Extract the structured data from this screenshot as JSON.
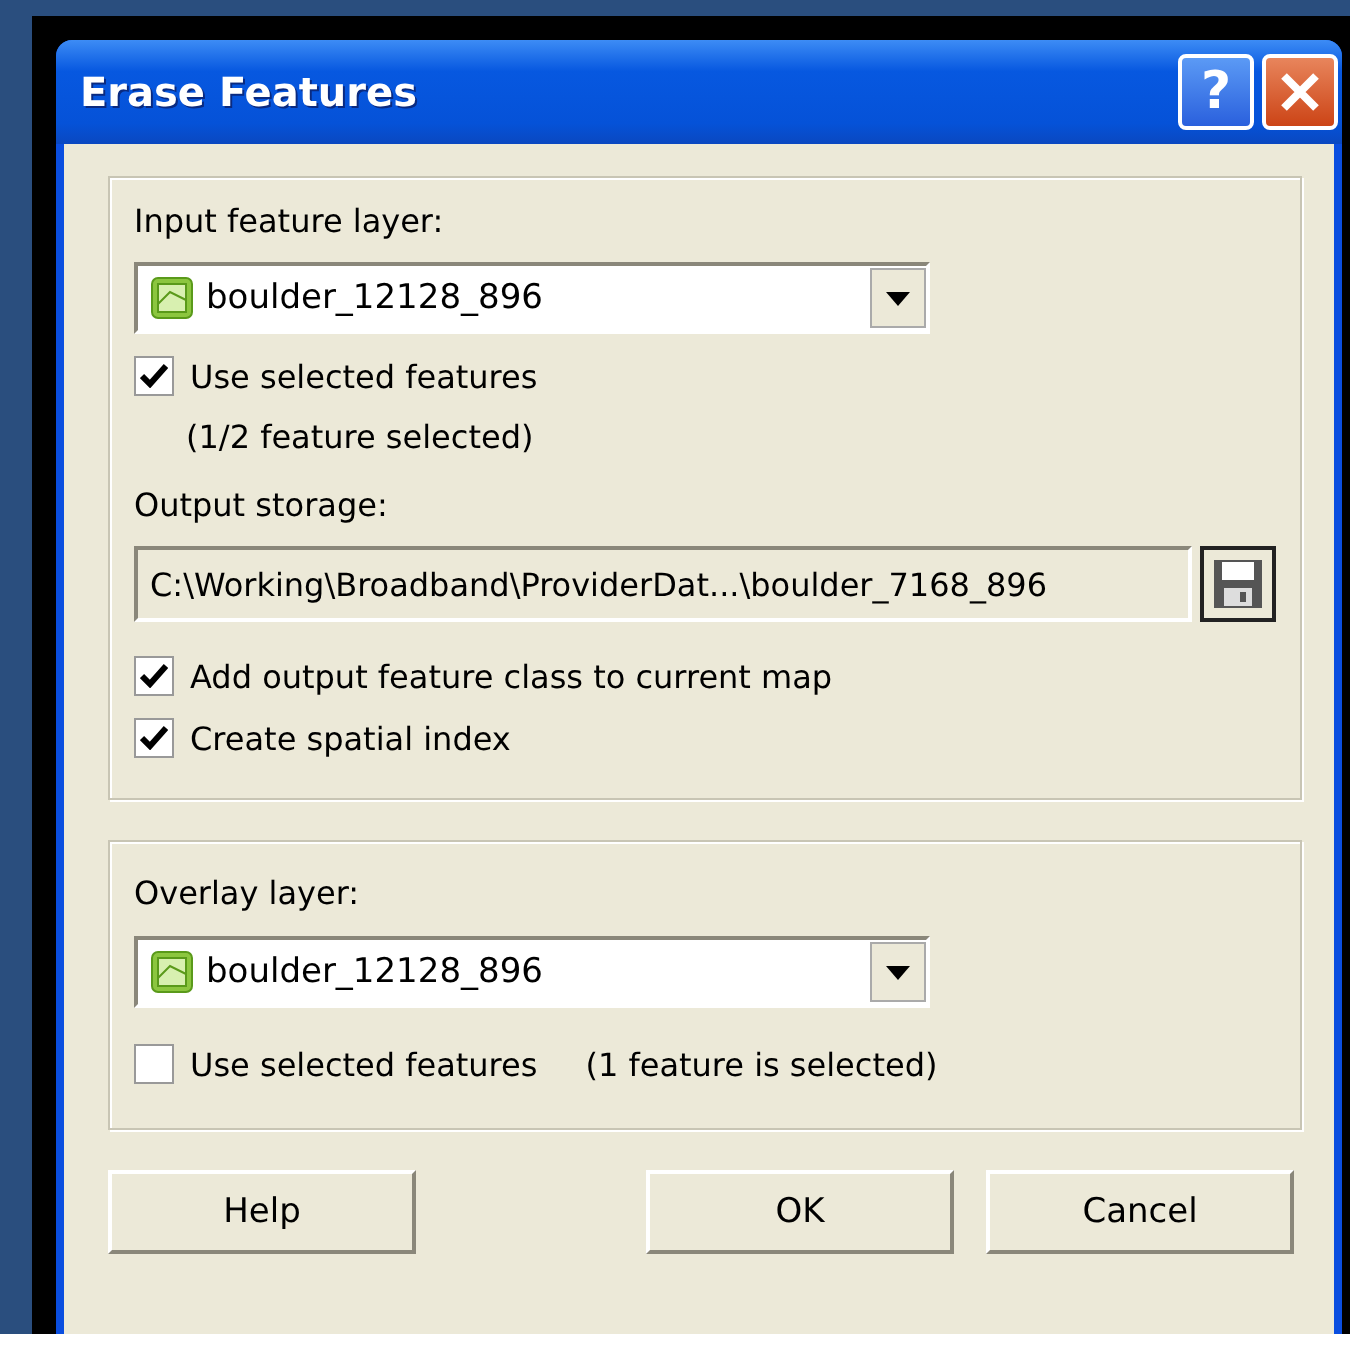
{
  "window": {
    "title": "Erase Features"
  },
  "title_buttons": [
    {
      "kind": "help",
      "label": "?"
    },
    {
      "kind": "close"
    }
  ],
  "input_group": {
    "label": "Input feature layer:",
    "layer": {
      "value": "boulder_12128_896"
    },
    "use_selected": {
      "label": "Use selected features",
      "checked": true
    },
    "selection_note": "(1/2 feature selected)",
    "output_label": "Output storage:",
    "output_path": "C:\\Working\\Broadband\\ProviderDat...\\boulder_7168_896",
    "options": [
      {
        "label": "Add output feature class to current map",
        "checked": true
      },
      {
        "label": "Create spatial index",
        "checked": true
      }
    ]
  },
  "overlay_group": {
    "label": "Overlay layer:",
    "layer": {
      "value": "boulder_12128_896"
    },
    "use_selected": {
      "label": "Use selected features",
      "checked": false
    },
    "selection_note": "(1 feature is selected)"
  },
  "buttons": [
    {
      "label": "Help",
      "kind": "left"
    },
    {
      "label": "OK",
      "kind": "right"
    },
    {
      "label": "Cancel",
      "kind": "right"
    }
  ]
}
